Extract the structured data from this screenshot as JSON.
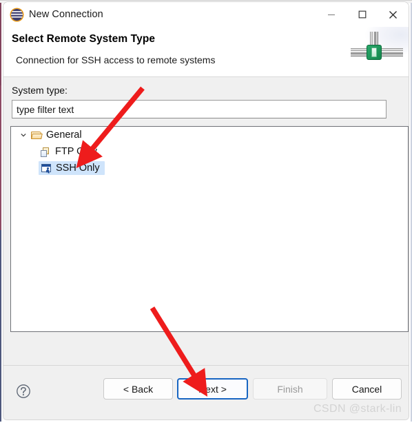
{
  "window": {
    "title": "New Connection",
    "app_icon": "eclipse-logo-icon",
    "controls": {
      "minimize": "minimize-icon",
      "maximize": "maximize-icon",
      "close": "close-icon"
    }
  },
  "banner": {
    "title": "Select Remote System Type",
    "subtitle": "Connection for SSH access to remote systems",
    "art": "network-connection-graphic"
  },
  "form": {
    "system_type_label": "System type:",
    "filter": {
      "value": "type filter text",
      "placeholder": "type filter text"
    }
  },
  "tree": {
    "items": [
      {
        "label": "General",
        "level": 0,
        "icon": "folder-open-icon",
        "expanded": true,
        "selected": false
      },
      {
        "label": "FTP Only",
        "level": 1,
        "icon": "ftp-connection-icon",
        "expanded": false,
        "selected": false
      },
      {
        "label": "SSH Only",
        "level": 1,
        "icon": "ssh-connection-icon",
        "expanded": false,
        "selected": true
      }
    ]
  },
  "footer": {
    "help_icon": "help-question-icon",
    "buttons": {
      "back": "< Back",
      "next": "Next >",
      "finish": "Finish",
      "cancel": "Cancel"
    }
  },
  "watermark": "CSDN @stark-lin",
  "annotations": {
    "arrow_color": "#ee1c1c",
    "arrow_to_ssh": "points at SSH Only tree item",
    "arrow_to_next": "points at Next > button"
  },
  "colors": {
    "selection": "#cfe4fb",
    "focus_border": "#1765c2",
    "dialog_bg": "#f0f0f0",
    "arrow_red": "#ee1c1c",
    "node_green": "#13874c"
  }
}
